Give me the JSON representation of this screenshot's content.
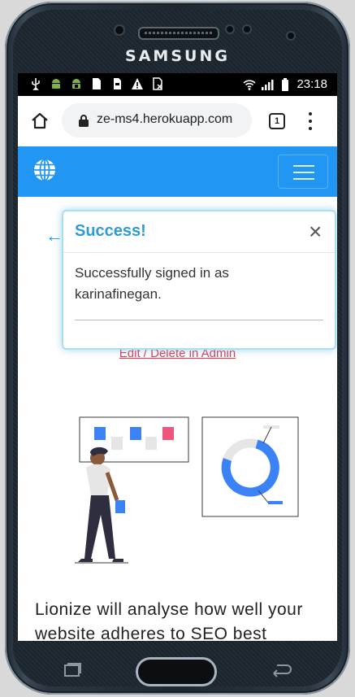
{
  "device": {
    "brand": "SAMSUNG"
  },
  "status_bar": {
    "time": "23:18"
  },
  "browser": {
    "url": "ze-ms4.herokuapp.com",
    "tab_count": "1"
  },
  "toast": {
    "title": "Success!",
    "close": "×",
    "message": "Successfully signed in as karinafinegan."
  },
  "page": {
    "back_arrow": "←",
    "admin_link": "Edit / Delete in Admin",
    "description": "Lionize will analyse how well your website adheres to SEO best"
  },
  "colors": {
    "accent": "#2196f3",
    "link": "#e6394f",
    "toast_title": "#2e9bd8"
  }
}
